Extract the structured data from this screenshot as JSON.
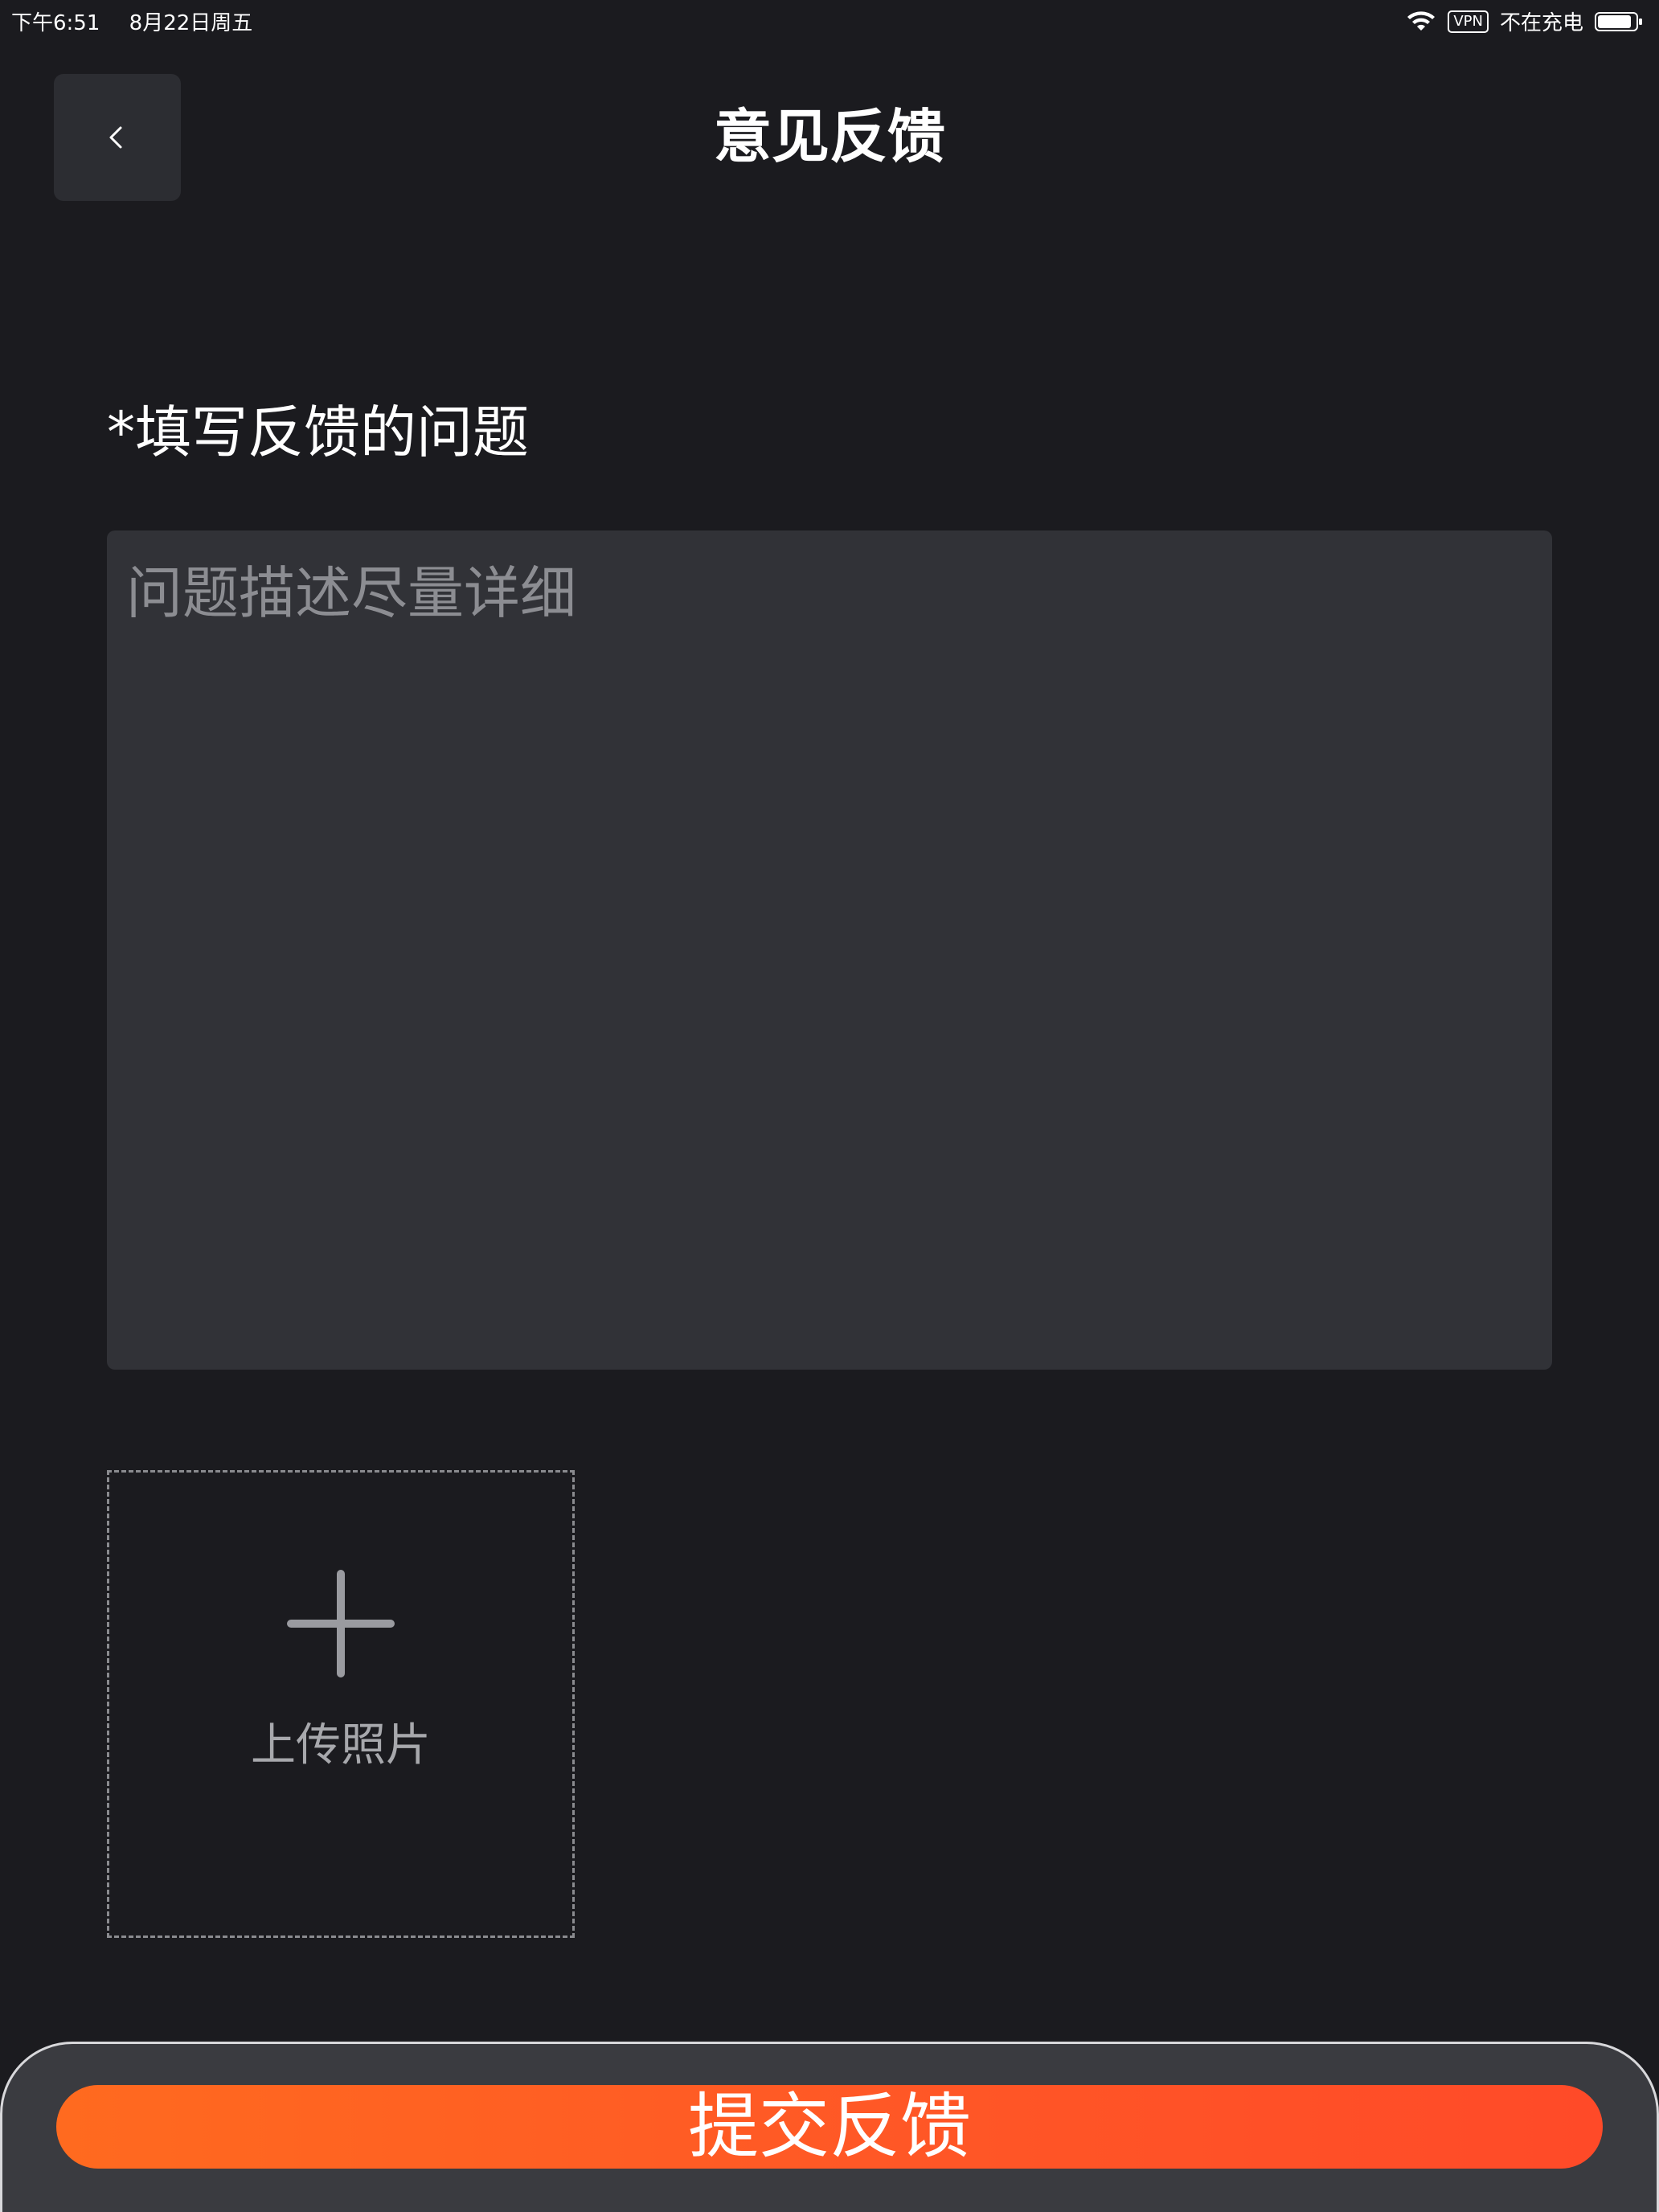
{
  "status_bar": {
    "time": "下午6:51",
    "date": "8月22日周五",
    "vpn": "VPN",
    "charging_status": "不在充电",
    "battery_level": 0.9
  },
  "header": {
    "title": "意见反馈"
  },
  "form": {
    "question_label": "*填写反馈的问题",
    "description_value": "",
    "description_placeholder": "问题描述尽量详细"
  },
  "upload": {
    "label": "上传照片"
  },
  "footer": {
    "submit_label": "提交反馈"
  },
  "colors": {
    "background": "#1b1b1f",
    "input_background": "#313237",
    "accent_start": "#ff6a1f",
    "accent_end": "#ff4a28"
  },
  "icons": {
    "back": "chevron-left-icon",
    "upload": "plus-icon",
    "wifi": "wifi-icon",
    "battery": "battery-icon"
  }
}
